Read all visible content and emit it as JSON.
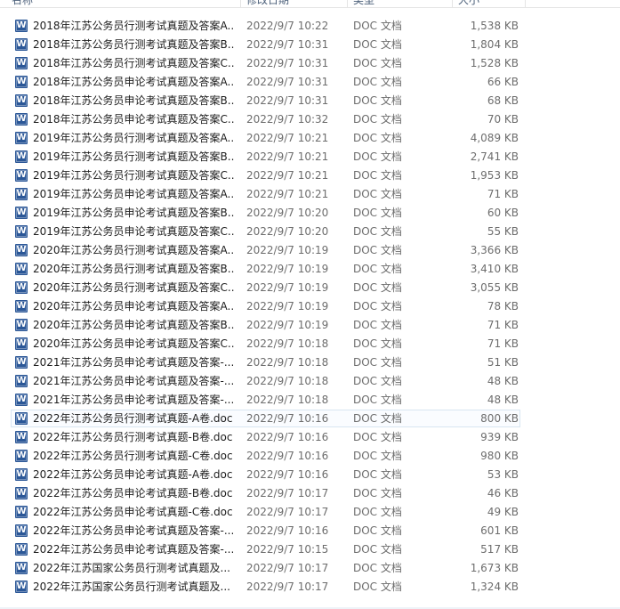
{
  "header": {
    "name": "名称",
    "date": "修改日期",
    "type": "类型",
    "size": "大小"
  },
  "files": [
    {
      "name": "2018年江苏公务员行测考试真题及答案A...",
      "date": "2022/9/7 10:22",
      "type": "DOC 文档",
      "size": "1,538 KB"
    },
    {
      "name": "2018年江苏公务员行测考试真题及答案B...",
      "date": "2022/9/7 10:31",
      "type": "DOC 文档",
      "size": "1,804 KB"
    },
    {
      "name": "2018年江苏公务员行测考试真题及答案C...",
      "date": "2022/9/7 10:31",
      "type": "DOC 文档",
      "size": "1,528 KB"
    },
    {
      "name": "2018年江苏公务员申论考试真题及答案A...",
      "date": "2022/9/7 10:31",
      "type": "DOC 文档",
      "size": "66 KB"
    },
    {
      "name": "2018年江苏公务员申论考试真题及答案B...",
      "date": "2022/9/7 10:31",
      "type": "DOC 文档",
      "size": "68 KB"
    },
    {
      "name": "2018年江苏公务员申论考试真题及答案C...",
      "date": "2022/9/7 10:32",
      "type": "DOC 文档",
      "size": "70 KB"
    },
    {
      "name": "2019年江苏公务员行测考试真题及答案A...",
      "date": "2022/9/7 10:21",
      "type": "DOC 文档",
      "size": "4,089 KB"
    },
    {
      "name": "2019年江苏公务员行测考试真题及答案B...",
      "date": "2022/9/7 10:21",
      "type": "DOC 文档",
      "size": "2,741 KB"
    },
    {
      "name": "2019年江苏公务员行测考试真题及答案C...",
      "date": "2022/9/7 10:21",
      "type": "DOC 文档",
      "size": "1,953 KB"
    },
    {
      "name": "2019年江苏公务员申论考试真题及答案A...",
      "date": "2022/9/7 10:21",
      "type": "DOC 文档",
      "size": "71 KB"
    },
    {
      "name": "2019年江苏公务员申论考试真题及答案B...",
      "date": "2022/9/7 10:20",
      "type": "DOC 文档",
      "size": "60 KB"
    },
    {
      "name": "2019年江苏公务员申论考试真题及答案C...",
      "date": "2022/9/7 10:20",
      "type": "DOC 文档",
      "size": "55 KB"
    },
    {
      "name": "2020年江苏公务员行测考试真题及答案A...",
      "date": "2022/9/7 10:19",
      "type": "DOC 文档",
      "size": "3,366 KB"
    },
    {
      "name": "2020年江苏公务员行测考试真题及答案B...",
      "date": "2022/9/7 10:19",
      "type": "DOC 文档",
      "size": "3,410 KB"
    },
    {
      "name": "2020年江苏公务员行测考试真题及答案C...",
      "date": "2022/9/7 10:19",
      "type": "DOC 文档",
      "size": "3,055 KB"
    },
    {
      "name": "2020年江苏公务员申论考试真题及答案A...",
      "date": "2022/9/7 10:19",
      "type": "DOC 文档",
      "size": "78 KB"
    },
    {
      "name": "2020年江苏公务员申论考试真题及答案B...",
      "date": "2022/9/7 10:19",
      "type": "DOC 文档",
      "size": "71 KB"
    },
    {
      "name": "2020年江苏公务员申论考试真题及答案C...",
      "date": "2022/9/7 10:18",
      "type": "DOC 文档",
      "size": "71 KB"
    },
    {
      "name": "2021年江苏公务员申论考试真题及答案-...",
      "date": "2022/9/7 10:18",
      "type": "DOC 文档",
      "size": "51 KB"
    },
    {
      "name": "2021年江苏公务员申论考试真题及答案-...",
      "date": "2022/9/7 10:18",
      "type": "DOC 文档",
      "size": "48 KB"
    },
    {
      "name": "2021年江苏公务员申论考试真题及答案-...",
      "date": "2022/9/7 10:18",
      "type": "DOC 文档",
      "size": "48 KB"
    },
    {
      "name": "2022年江苏公务员行测考试真题-A卷.doc",
      "date": "2022/9/7 10:16",
      "type": "DOC 文档",
      "size": "800 KB"
    },
    {
      "name": "2022年江苏公务员行测考试真题-B卷.doc",
      "date": "2022/9/7 10:16",
      "type": "DOC 文档",
      "size": "939 KB"
    },
    {
      "name": "2022年江苏公务员行测考试真题-C卷.doc",
      "date": "2022/9/7 10:16",
      "type": "DOC 文档",
      "size": "980 KB"
    },
    {
      "name": "2022年江苏公务员申论考试真题-A卷.doc",
      "date": "2022/9/7 10:16",
      "type": "DOC 文档",
      "size": "53 KB"
    },
    {
      "name": "2022年江苏公务员申论考试真题-B卷.doc",
      "date": "2022/9/7 10:17",
      "type": "DOC 文档",
      "size": "46 KB"
    },
    {
      "name": "2022年江苏公务员申论考试真题-C卷.doc",
      "date": "2022/9/7 10:17",
      "type": "DOC 文档",
      "size": "49 KB"
    },
    {
      "name": "2022年江苏公务员申论考试真题及答案-...",
      "date": "2022/9/7 10:16",
      "type": "DOC 文档",
      "size": "601 KB"
    },
    {
      "name": "2022年江苏公务员申论考试真题及答案-...",
      "date": "2022/9/7 10:15",
      "type": "DOC 文档",
      "size": "517 KB"
    },
    {
      "name": "2022年江苏国家公务员行测考试真题及...",
      "date": "2022/9/7 10:17",
      "type": "DOC 文档",
      "size": "1,673 KB"
    },
    {
      "name": "2022年江苏国家公务员行测考试真题及...",
      "date": "2022/9/7 10:17",
      "type": "DOC 文档",
      "size": "1,324 KB"
    }
  ],
  "selected_index": 21,
  "icon": {
    "name": "word-doc-icon",
    "glyph": "W",
    "color": "#2b5797"
  }
}
